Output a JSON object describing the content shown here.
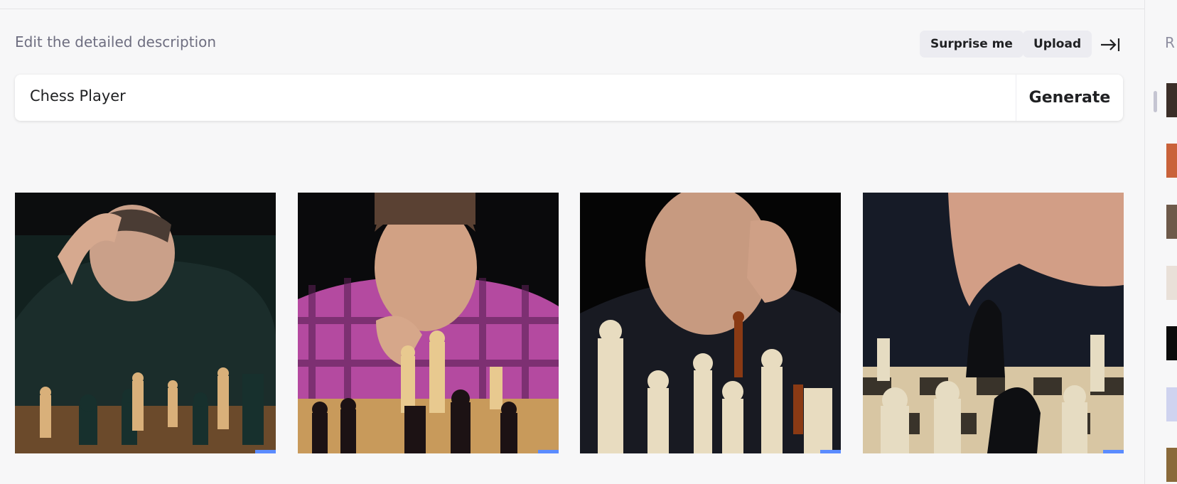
{
  "editor": {
    "label": "Edit the detailed description",
    "surprise_label": "Surprise me",
    "upload_label": "Upload",
    "prompt_value": "Chess Player",
    "generate_label": "Generate"
  },
  "sidebar": {
    "heading_visible": "R"
  },
  "images": [
    {
      "subject": "older man holding head over dark chess pieces"
    },
    {
      "subject": "young man in pink plaid shirt with hand at mouth"
    },
    {
      "subject": "bald man resting head on hand behind white pieces"
    },
    {
      "subject": "hand moving black knight over pawns"
    }
  ]
}
